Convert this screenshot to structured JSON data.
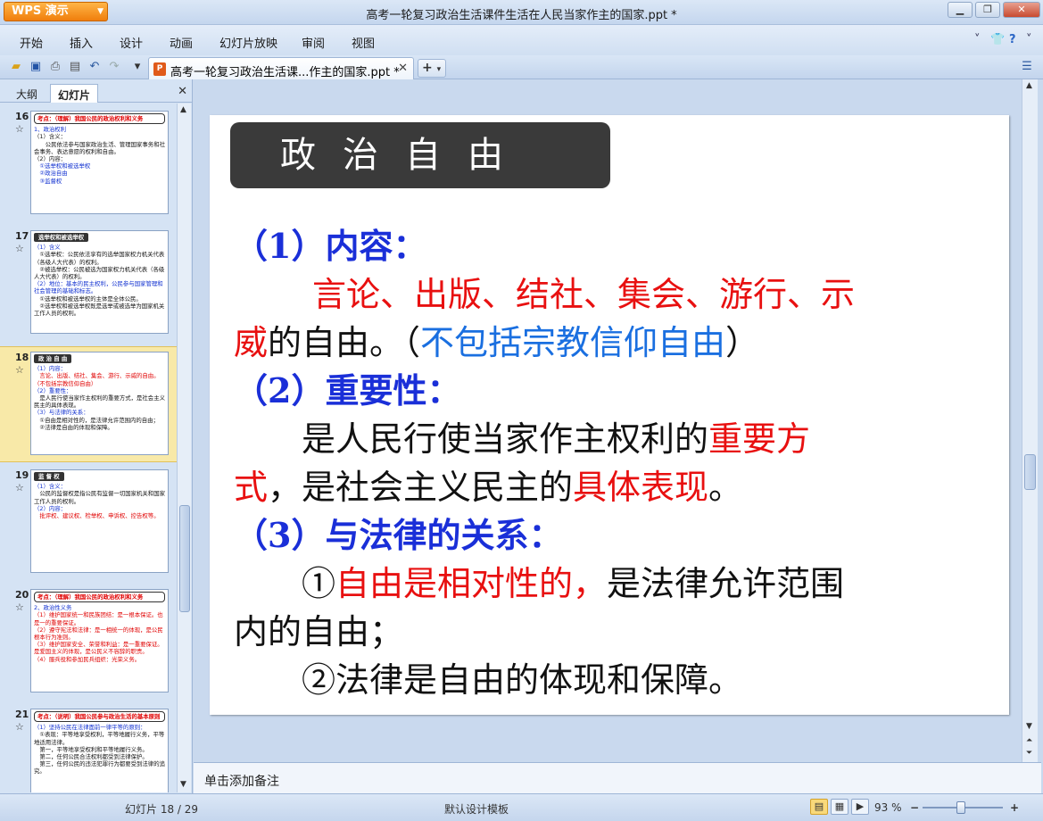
{
  "window": {
    "app_button": "WPS 演示",
    "title": "高考一轮复习政治生活课件生活在人民当家作主的国家.ppt *"
  },
  "menu": [
    "开始",
    "插入",
    "设计",
    "动画",
    "幻灯片放映",
    "审阅",
    "视图"
  ],
  "toolbar": {
    "doc_tab_label": "高考一轮复习政治生活课...作主的国家.ppt *"
  },
  "left_panel": {
    "tabs": [
      "大纲",
      "幻灯片"
    ],
    "thumbnails": [
      {
        "num": "16",
        "box": "考点：（理解）我国公民的政治权利和义务",
        "lines": [
          {
            "c": "blue",
            "t": "1、政治权利"
          },
          {
            "c": "black",
            "t": "（1）含义："
          },
          {
            "c": "black",
            "t": "　　公民依法参与国家政治生活、管理国家事务和社会事务、表达意愿的权利和自由。"
          },
          {
            "c": "black",
            "t": "（2）内容："
          },
          {
            "c": "blue",
            "t": "　①选举权和被选举权"
          },
          {
            "c": "blue",
            "t": "　②政治自由"
          },
          {
            "c": "blue",
            "t": "　③监督权"
          }
        ]
      },
      {
        "num": "17",
        "box": "选举权和被选举权",
        "lines": [
          {
            "c": "blue",
            "t": "（1）含义"
          },
          {
            "c": "black",
            "t": "　①选举权：公民依法享有的选举国家权力机关代表（各级人大代表）的权利。"
          },
          {
            "c": "black",
            "t": "　②被选举权：公民被选为国家权力机关代表（各级人大代表）的权利。"
          },
          {
            "c": "blue",
            "t": "（2）地位：基本的民主权利，公民参与国家管理和社会管理的基础和标志。"
          },
          {
            "c": "black",
            "t": "　①选举权和被选举权的主体是全体公民。"
          },
          {
            "c": "black",
            "t": "　②选举权和被选举权既是选举或被选举为国家机关工作人员的权利。"
          }
        ]
      },
      {
        "num": "18",
        "box": "政 治 自 由",
        "lines": [
          {
            "c": "blue",
            "t": "（1）内容："
          },
          {
            "c": "red",
            "t": "　言论、出版、结社、集会、游行、示威的自由。（不包括宗教信仰自由）"
          },
          {
            "c": "blue",
            "t": "（2）重要性："
          },
          {
            "c": "black",
            "t": "　是人民行使当家作主权利的重要方式，是社会主义民主的具体表现。"
          },
          {
            "c": "blue",
            "t": "（3）与法律的关系："
          },
          {
            "c": "black",
            "t": "　①自由是相对性的，是法律允许范围内的自由；"
          },
          {
            "c": "black",
            "t": "　②法律是自由的体现和保障。"
          }
        ]
      },
      {
        "num": "19",
        "box": "监 督 权",
        "lines": [
          {
            "c": "blue",
            "t": "（1）含义："
          },
          {
            "c": "black",
            "t": "　公民的监督权是指公民有监督一切国家机关和国家工作人员的权利。"
          },
          {
            "c": "blue",
            "t": "（2）内容："
          },
          {
            "c": "red",
            "t": "　批评权、建议权、检举权、申诉权、控告权等。"
          }
        ]
      },
      {
        "num": "20",
        "box": "考点：（理解）我国公民的政治权利和义务",
        "lines": [
          {
            "c": "blue",
            "t": "2、政治性义务"
          },
          {
            "c": "red",
            "t": "（1）维护国家统一和民族团结：是一根本保证。也是一的重要保证。"
          },
          {
            "c": "red",
            "t": "（2）遵守宪法和法律：是一相统一的体现，是公民根本行为准则。"
          },
          {
            "c": "red",
            "t": "（3）维护国家安全、荣誉和利益：是一重要保证。是爱国主义的体现，是公民义不容辞的职责。"
          },
          {
            "c": "red",
            "t": "（4）服兵役和参加民兵组织：光荣义务。"
          }
        ]
      },
      {
        "num": "21",
        "box": "考点：（说明）我国公民参与政治生活的基本原则",
        "lines": [
          {
            "c": "blue",
            "t": "（1）坚持公民在法律面前一律平等的原则："
          },
          {
            "c": "black",
            "t": "　①表现：平等地享受权利，平等地履行义务，平等地适用法律。"
          },
          {
            "c": "black",
            "t": "　第一，平等地享受权利和平等地履行义务。"
          },
          {
            "c": "black",
            "t": "　第二，任何公民合法权利都受到法律保护。"
          },
          {
            "c": "black",
            "t": "　第三，任何公民的违法犯罪行为都要受到法律的追究。"
          }
        ]
      }
    ]
  },
  "slide": {
    "title": "政治自由",
    "body": {
      "h1": "（1）内容：",
      "l1_red": "言论、出版、结社、集会、游行、示",
      "l2_red": "威",
      "l2_black": "的自由。（",
      "l2_blue": "不包括宗教信仰自由",
      "l2_end": "）",
      "h2": "（2）重要性：",
      "l3_black": "是人民行使当家作主权利的",
      "l3_red": "重要方",
      "l4_red": "式",
      "l4_black": "，是社会主义民主的",
      "l4_red2": "具体表现",
      "l4_end": "。",
      "h3": "（3）与法律的关系：",
      "l5_black": "①",
      "l5_red": "自由是相对性的，",
      "l5_black2": "是法律允许范围",
      "l6_black": "内的自由；",
      "l7_black": "②法律是自由的体现和保障。"
    }
  },
  "notes": {
    "placeholder": "单击添加备注"
  },
  "status": {
    "slide_counter": "幻灯片 18 / 29",
    "template": "默认设计模板",
    "zoom": "93 %"
  }
}
